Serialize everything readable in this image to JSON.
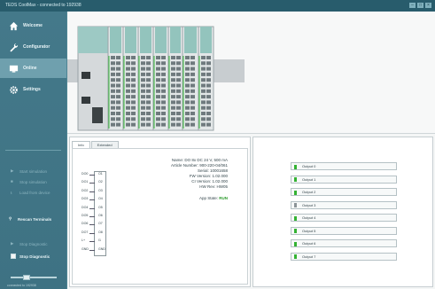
{
  "window": {
    "title": "TEDS CoolMax - connected to 192938"
  },
  "sidebar": {
    "items": [
      {
        "label": "Welcome",
        "icon": "home-icon"
      },
      {
        "label": "Configurator",
        "icon": "wrench-icon"
      },
      {
        "label": "Online",
        "icon": "monitor-icon"
      },
      {
        "label": "Settings",
        "icon": "gear-icon"
      }
    ],
    "actions": [
      {
        "label": "Start simulation",
        "enabled": false
      },
      {
        "label": "Stop simulation",
        "enabled": false
      },
      {
        "label": "Load from device",
        "enabled": false
      }
    ],
    "rescan": {
      "label": "Rescan Terminals"
    },
    "diag": [
      {
        "label": "Stop Diagnostic",
        "enabled": false
      },
      {
        "label": "Stop Diagnostic",
        "enabled": true
      }
    ],
    "version": "connected to 192938"
  },
  "device": {
    "modules": [
      "CPU",
      "DO 8x",
      "DI 8x",
      "AI 4x",
      "AO 4x",
      "DO 8x",
      "DI 8x"
    ]
  },
  "info_panel": {
    "tabs": [
      "Info",
      "Extended"
    ],
    "fields": [
      {
        "label": "Name:",
        "value": "DO 8x DC 24 V, 500 mA"
      },
      {
        "label": "Article Number:",
        "value": "900-220-04/061"
      },
      {
        "label": "Serial:",
        "value": "10001658"
      },
      {
        "label": "FW Version:",
        "value": "1.02.000"
      },
      {
        "label": "CI Version:",
        "value": "1.02.000"
      },
      {
        "label": "HW Rev:",
        "value": "HW05"
      }
    ],
    "app_state_label": "App State:",
    "app_state_value": "RUN",
    "pins": [
      "DO0",
      "DO1",
      "DO2",
      "DO3",
      "DO4",
      "DO5",
      "DO6",
      "DO7",
      "L+",
      "GND"
    ],
    "pin_labels": [
      "O1",
      "O2",
      "O3",
      "O4",
      "O5",
      "O6",
      "O7",
      "O8",
      "I1",
      "GND"
    ]
  },
  "outputs": [
    {
      "label": "Output 0",
      "on": true
    },
    {
      "label": "Output 1",
      "on": true
    },
    {
      "label": "Output 2",
      "on": true
    },
    {
      "label": "Output 3",
      "on": false
    },
    {
      "label": "Output 4",
      "on": true
    },
    {
      "label": "Output 5",
      "on": true
    },
    {
      "label": "Output 6",
      "on": true
    },
    {
      "label": "Output 7",
      "on": true
    }
  ],
  "colors": {
    "sidebar": "#3e7283",
    "active_nav": "#6fa0ae",
    "led_on": "#33b233",
    "state_run": "#2b9a2b"
  }
}
